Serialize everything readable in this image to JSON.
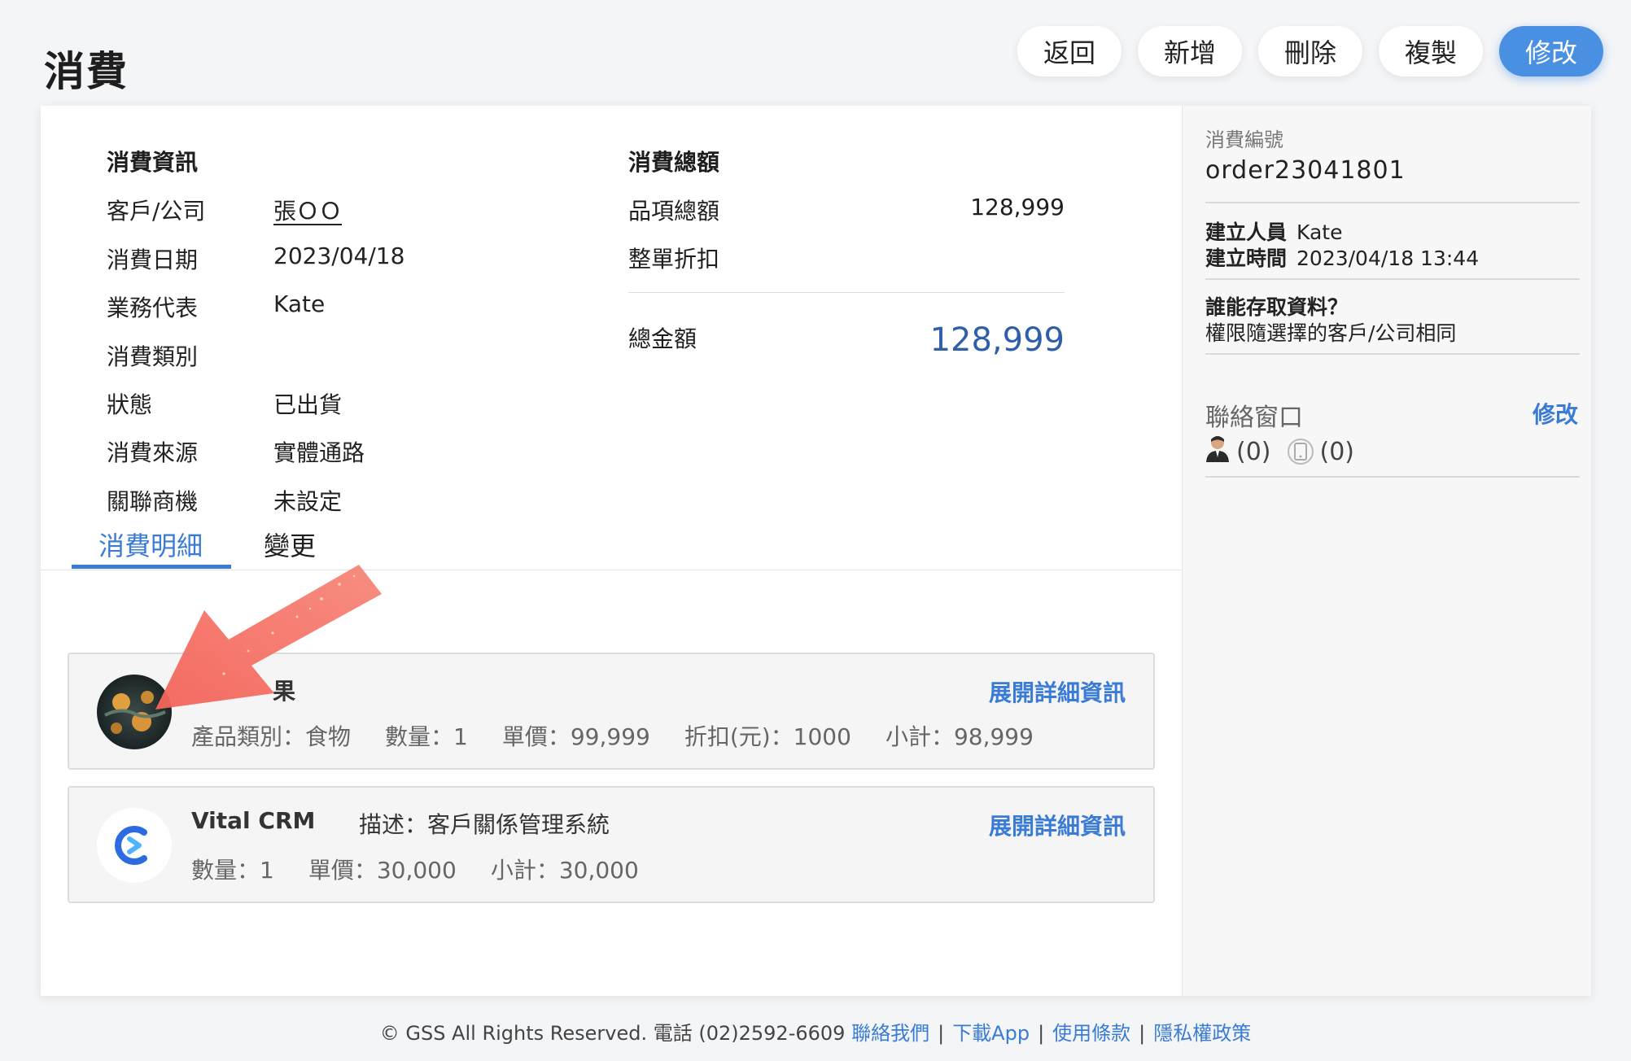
{
  "page": {
    "title": "消費"
  },
  "toolbar": {
    "back": "返回",
    "add": "新增",
    "delete": "刪除",
    "copy": "複製",
    "edit": "修改"
  },
  "info": {
    "title": "消費資訊",
    "rows": [
      {
        "label": "客戶/公司",
        "value": "張ＯＯ"
      },
      {
        "label": "消費日期",
        "value": "2023/04/18"
      },
      {
        "label": "業務代表",
        "value": "Kate"
      },
      {
        "label": "消費類別",
        "value": ""
      },
      {
        "label": "狀態",
        "value": "已出貨"
      },
      {
        "label": "消費來源",
        "value": "實體通路"
      },
      {
        "label": "關聯商機",
        "value": "未設定"
      }
    ]
  },
  "summary": {
    "title": "消費總額",
    "items_total_label": "品項總額",
    "items_total_value": "128,999",
    "discount_label": "整單折扣",
    "discount_value": "",
    "grand_total_label": "總金額",
    "grand_total_value": "128,999"
  },
  "tabs": [
    {
      "label": "消費明細"
    },
    {
      "label": "變更"
    }
  ],
  "items": [
    {
      "name": "果",
      "description": "",
      "meta": [
        "產品類別：食物",
        "數量：1",
        "單價：99,999",
        "折扣(元)：1000",
        "小計：98,999"
      ],
      "expand_label": "展開詳細資訊"
    },
    {
      "name": "Vital CRM",
      "description": "描述：客戶關係管理系統",
      "meta": [
        "數量：1",
        "單價：30,000",
        "小計：30,000"
      ],
      "expand_label": "展開詳細資訊"
    }
  ],
  "sidebar": {
    "order_no_label": "消費編號",
    "order_no": "order23041801",
    "created_by_label": "建立人員",
    "created_by": "Kate",
    "created_at_label": "建立時間",
    "created_at": "2023/04/18 13:44",
    "access_label": "誰能存取資料？",
    "access_value": "權限隨選擇的客戶/公司相同",
    "contact_title": "聯絡窗口",
    "contact_edit": "修改",
    "contact_person_count": "(0)",
    "contact_phone_count": "(0)"
  },
  "footer": {
    "copyright": "© GSS All Rights Reserved. 電話 (02)2592-6609",
    "links": [
      "聯絡我們",
      "下載App",
      "使用條款",
      "隱私權政策"
    ]
  },
  "colors": {
    "accent": "#3a7bd5",
    "primary_button": "#4a90e2",
    "total": "#2f5fa8",
    "arrow": "#f26b5b"
  },
  "icons": [
    "person-icon",
    "phone-icon",
    "product-fruit-thumbnail",
    "vital-crm-logo",
    "annotation-arrow"
  ]
}
